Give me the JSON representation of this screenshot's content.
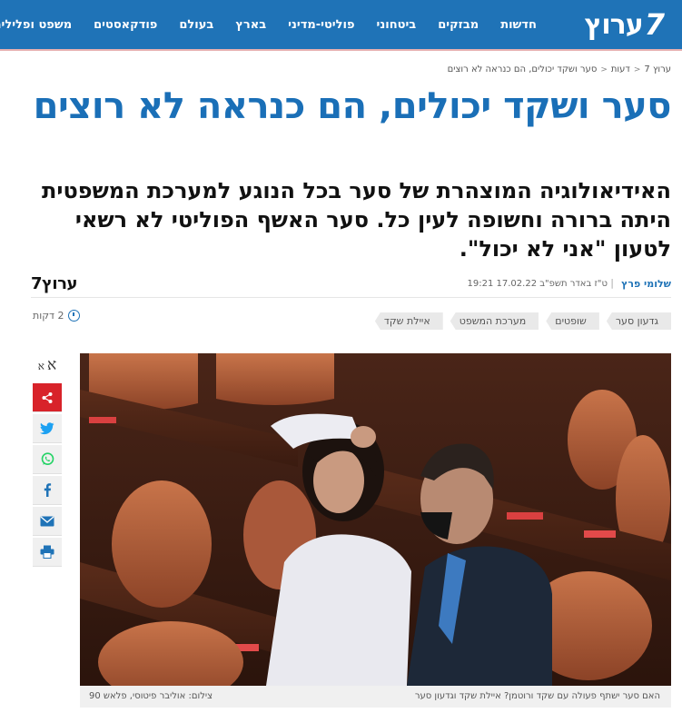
{
  "site": {
    "logo_text": "ערוץ",
    "logo_seven": "7",
    "nav": [
      "חדשות",
      "מבזקים",
      "ביטחוני",
      "פוליטי-מדיני",
      "בארץ",
      "בעולם",
      "פודקאסטים",
      "משפט ופלילים"
    ]
  },
  "breadcrumb": {
    "items": [
      "ערוץ 7",
      "דעות",
      "סער ושקד יכולים, הם כנראה לא רוצים"
    ],
    "separator": "<"
  },
  "article": {
    "title": "סער ושקד יכולים, הם כנראה לא רוצים",
    "subtitle": "האידיאולוגיה המוצהרת של סער בכל הנוגע למערכת המשפטית היתה ברורה וחשופה לעין כל. סער האשף הפוליטי לא רשאי לטעון \"אני לא יכול\".",
    "author": "שלומי פרץ",
    "date": "ט\"ז באדר תשפ\"ב 17.02.22 19:21",
    "meta_logo": "ערוץ7",
    "read_time": "2 דקות",
    "tags": [
      "גדעון סער",
      "שופטים",
      "מערכת המשפט",
      "איילת שקד"
    ]
  },
  "share": {
    "font_big": "א",
    "font_small": "א",
    "buttons": [
      "share-icon",
      "twitter-icon",
      "whatsapp-icon",
      "facebook-icon",
      "email-icon",
      "print-icon"
    ],
    "accent": "#d8232a"
  },
  "photo": {
    "caption": "האם סער ישתף פעולה עם שקד ורוטמן? איילת שקד וגדעון סער",
    "credit": "צילום: אוליבר פיטוסי, פלאש 90"
  },
  "colors": {
    "brand": "#1f73b7",
    "title": "#1a6fb7"
  }
}
